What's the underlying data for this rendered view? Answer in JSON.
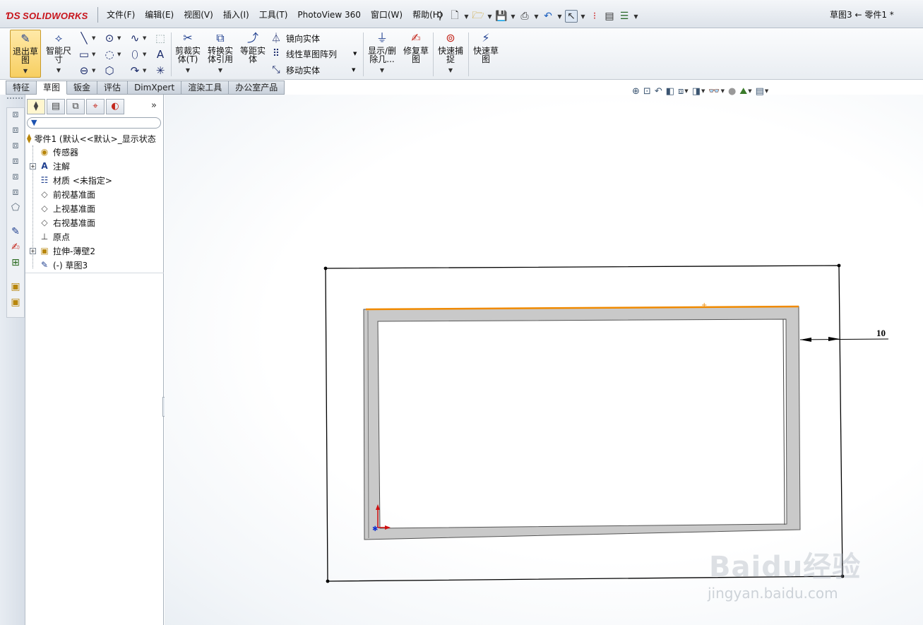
{
  "app": {
    "logo_text": "SOLIDWORKS",
    "window_title": "草图3 ← 零件1 *"
  },
  "menus": [
    "文件(F)",
    "编辑(E)",
    "视图(V)",
    "插入(I)",
    "工具(T)",
    "PhotoView 360",
    "窗口(W)",
    "帮助(H)"
  ],
  "quickbar": [
    "pin-icon",
    "new-document-icon",
    "open-folder-icon",
    "save-icon",
    "print-icon",
    "undo-icon",
    "select-pointer-icon",
    "rebuild-traffic-light-icon",
    "file-properties-icon",
    "options-list-icon"
  ],
  "commands": {
    "exit_sketch": "退出草图",
    "smart_dimension": "智能尺寸",
    "trim_entities": "剪裁实体(T)",
    "convert_entities": "转换实体引用",
    "offset_entities": "等距实体",
    "mirror_entities": "镜向实体",
    "linear_pattern": "线性草图阵列",
    "move_entities": "移动实体",
    "display_delete_relations": "显示/删除几...",
    "repair_sketch": "修复草图",
    "quick_snaps": "快速捕捉",
    "rapid_sketch": "快速草图"
  },
  "tabs": [
    {
      "label": "特征",
      "active": false
    },
    {
      "label": "草图",
      "active": true
    },
    {
      "label": "钣金",
      "active": false
    },
    {
      "label": "评估",
      "active": false
    },
    {
      "label": "DimXpert",
      "active": false
    },
    {
      "label": "渲染工具",
      "active": false
    },
    {
      "label": "办公室产品",
      "active": false
    }
  ],
  "tree": {
    "root": "零件1  (默认<<默认>_显示状态",
    "items": [
      {
        "label": "传感器",
        "icon": "sensor-icon",
        "expandable": false
      },
      {
        "label": "注解",
        "icon": "annotation-icon",
        "expandable": true
      },
      {
        "label": "材质 <未指定>",
        "icon": "material-icon",
        "expandable": false
      },
      {
        "label": "前视基准面",
        "icon": "plane-icon",
        "expandable": false
      },
      {
        "label": "上视基准面",
        "icon": "plane-icon",
        "expandable": false
      },
      {
        "label": "右视基准面",
        "icon": "plane-icon",
        "expandable": false
      },
      {
        "label": "原点",
        "icon": "origin-icon",
        "expandable": false
      },
      {
        "label": "拉伸-薄壁2",
        "icon": "extrude-icon",
        "expandable": true
      },
      {
        "label": "(-) 草图3",
        "icon": "sketch-icon",
        "expandable": false
      }
    ]
  },
  "graphics": {
    "dimension_value": "10",
    "colors": {
      "selected_edge": "#f08a00",
      "wall_fill": "#c9c9c9",
      "sketch_line": "#000000",
      "origin_y": "#d01010",
      "origin_x": "#1030d0"
    }
  },
  "watermark": {
    "main": "Baidu经验",
    "sub": "jingyan.baidu.com"
  }
}
